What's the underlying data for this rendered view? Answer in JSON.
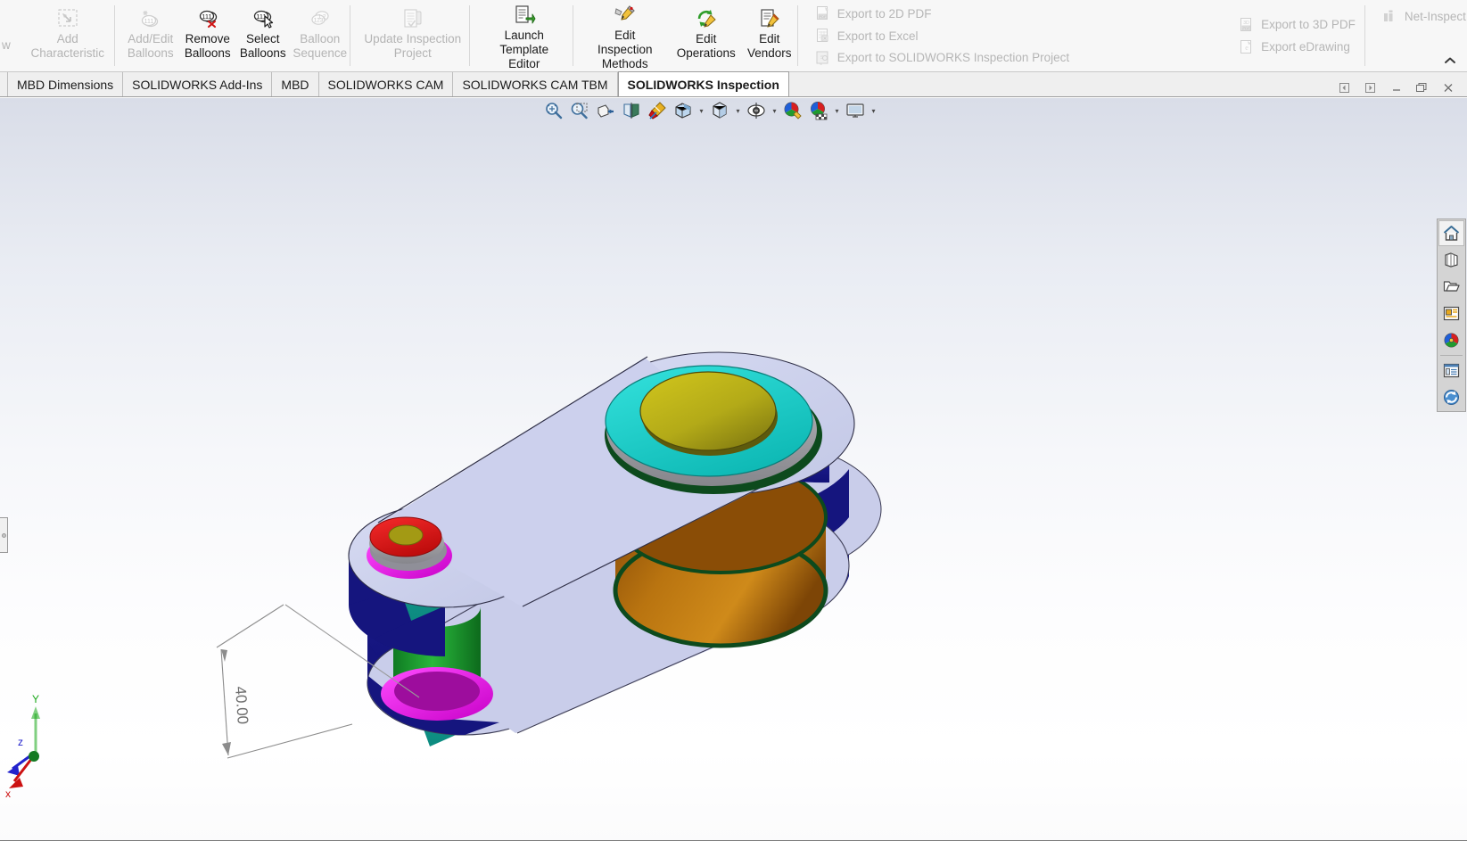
{
  "ribbon": {
    "left_cut_label": "w",
    "groups": [
      {
        "name": "characteristic",
        "commands": [
          {
            "label": "Add\nCharacteristic",
            "icon": "add-characteristic-icon",
            "disabled": true
          }
        ]
      },
      {
        "name": "balloons",
        "commands": [
          {
            "label": "Add/Edit\nBalloons",
            "icon": "add-edit-balloons-icon",
            "disabled": true
          },
          {
            "label": "Remove\nBalloons",
            "icon": "remove-balloons-icon",
            "disabled": false
          },
          {
            "label": "Select\nBalloons",
            "icon": "select-balloons-icon",
            "disabled": false
          },
          {
            "label": "Balloon\nSequence",
            "icon": "balloon-sequence-icon",
            "disabled": true
          }
        ]
      },
      {
        "name": "project",
        "commands": [
          {
            "label": "Update Inspection\nProject",
            "icon": "update-inspection-project-icon",
            "disabled": true
          }
        ]
      },
      {
        "name": "template",
        "commands": [
          {
            "label": "Launch\nTemplate Editor",
            "icon": "launch-template-editor-icon",
            "disabled": false
          }
        ]
      },
      {
        "name": "edit",
        "commands": [
          {
            "label": "Edit Inspection\nMethods",
            "icon": "edit-inspection-methods-icon",
            "disabled": false
          },
          {
            "label": "Edit\nOperations",
            "icon": "edit-operations-icon",
            "disabled": false
          },
          {
            "label": "Edit\nVendors",
            "icon": "edit-vendors-icon",
            "disabled": false
          }
        ]
      }
    ],
    "export_column_1": [
      {
        "label": "Export to 2D PDF",
        "icon": "export-2d-pdf-icon",
        "disabled": true
      },
      {
        "label": "Export to Excel",
        "icon": "export-excel-icon",
        "disabled": true
      },
      {
        "label": "Export to SOLIDWORKS Inspection Project",
        "icon": "export-inspection-project-icon",
        "disabled": true
      }
    ],
    "export_column_2": [
      {
        "label": "Export to 3D PDF",
        "icon": "export-3d-pdf-icon",
        "disabled": true
      },
      {
        "label": "Export eDrawing",
        "icon": "export-edrawing-icon",
        "disabled": true
      }
    ],
    "netinspect": {
      "label": "Net-Inspect",
      "icon": "net-inspect-icon",
      "disabled": true
    },
    "collapse_icon": "chevron-up-icon"
  },
  "tabs": [
    {
      "label": "MBD Dimensions",
      "active": false
    },
    {
      "label": "SOLIDWORKS Add-Ins",
      "active": false
    },
    {
      "label": "MBD",
      "active": false
    },
    {
      "label": "SOLIDWORKS CAM",
      "active": false
    },
    {
      "label": "SOLIDWORKS CAM TBM",
      "active": false
    },
    {
      "label": "SOLIDWORKS Inspection",
      "active": true
    }
  ],
  "window_controls": [
    {
      "name": "restore-left-icon",
      "glyph": "◁"
    },
    {
      "name": "restore-right-icon",
      "glyph": "▷"
    },
    {
      "name": "minimize-icon",
      "glyph": "—"
    },
    {
      "name": "maximize-icon",
      "glyph": "❐"
    },
    {
      "name": "close-icon",
      "glyph": "✕"
    }
  ],
  "view_toolbar": [
    {
      "name": "zoom-to-fit-icon",
      "caret": false
    },
    {
      "name": "zoom-to-area-icon",
      "caret": false
    },
    {
      "name": "section-view-icon",
      "caret": false
    },
    {
      "name": "view-orientation-flip-icon",
      "caret": false
    },
    {
      "name": "apply-scene-brush-icon",
      "caret": false
    },
    {
      "name": "view-orientation-icon",
      "caret": true
    },
    {
      "name": "display-style-icon",
      "caret": true
    },
    {
      "name": "hide-show-items-icon",
      "caret": true
    },
    {
      "name": "edit-appearance-icon",
      "caret": false
    },
    {
      "name": "apply-scene-icon",
      "caret": true
    },
    {
      "name": "view-settings-icon",
      "caret": true
    }
  ],
  "right_toolbar": [
    {
      "name": "home-icon",
      "selected": true
    },
    {
      "name": "appearances-icon",
      "selected": false
    },
    {
      "name": "folder-icon",
      "selected": false
    },
    {
      "name": "custom-properties-icon",
      "selected": false
    },
    {
      "name": "display-manager-icon",
      "selected": false
    },
    {
      "name": "view-palette-icon",
      "selected": false
    },
    {
      "name": "refresh-icon",
      "selected": false
    }
  ],
  "graphics": {
    "dimension_value": "40.00",
    "triad": {
      "x_label": "x",
      "y_label": "Y",
      "z_label": "z"
    },
    "colors": {
      "body_top": "#ccd0ed",
      "body_edge_blue": "#1a1a8c",
      "body_side_teal": "#0f9e91",
      "hub_cyan": "#1fd1cd",
      "hub_olive": "#a9a316",
      "bore_orange": "#b06c14",
      "pin_green": "#17a030",
      "ring_magenta": "#e81ce8",
      "cap_red": "#e01414",
      "rim_darkgreen": "#0d4a1d",
      "bg_top": "#d9dde8",
      "bg_bottom": "#ffffff"
    }
  }
}
